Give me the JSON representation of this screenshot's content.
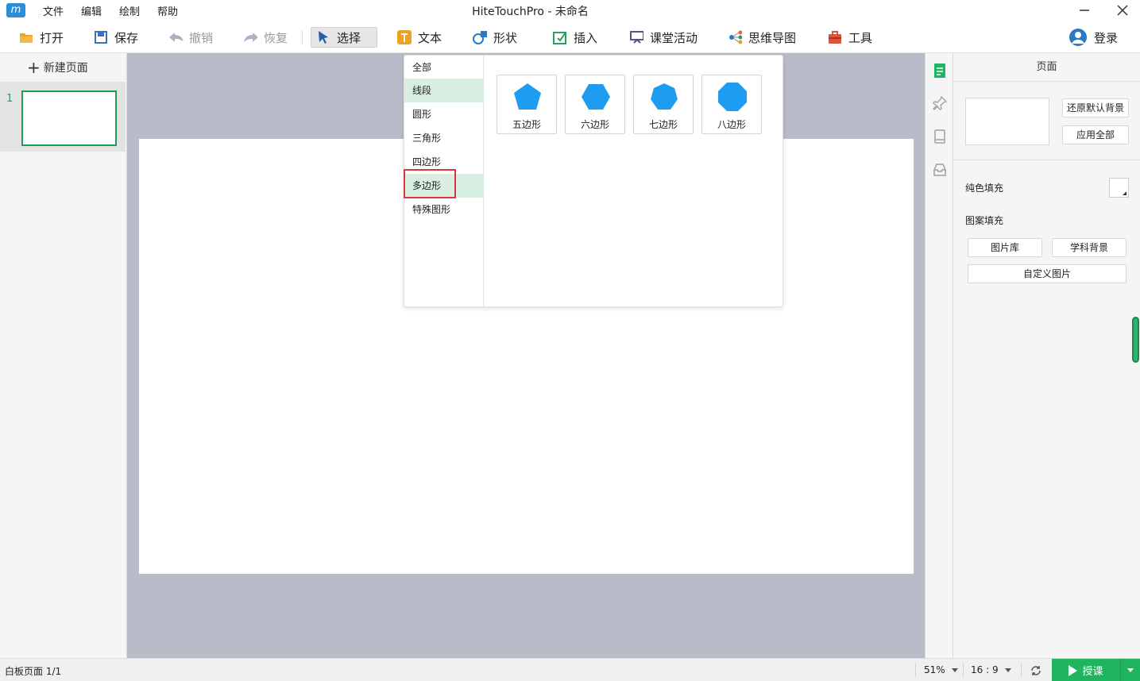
{
  "menu": [
    "文件",
    "编辑",
    "绘制",
    "帮助"
  ],
  "window_title": "HiteTouchPro - 未命名",
  "toolbar": {
    "open": "打开",
    "save": "保存",
    "undo": "撤销",
    "redo": "恢复",
    "select": "选择",
    "text": "文本",
    "shape": "形状",
    "insert": "插入",
    "class_activity": "课堂活动",
    "mind_map": "思维导图",
    "tools": "工具",
    "login": "登录"
  },
  "left_panel": {
    "new_page": "新建页面",
    "pages": [
      {
        "number": "1"
      }
    ]
  },
  "shape_popup": {
    "categories": [
      "全部",
      "线段",
      "圆形",
      "三角形",
      "四边形",
      "多边形",
      "特殊图形"
    ],
    "selected_category": "多边形",
    "shapes": [
      "五边形",
      "六边形",
      "七边形",
      "八边形"
    ],
    "shape_color": "#1e9cf0"
  },
  "props": {
    "title": "页面",
    "reset_bg": "还原默认背景",
    "apply_all": "应用全部",
    "solid_fill": "纯色填充",
    "pattern_fill": "图案填充",
    "image_lib": "图片库",
    "subject_bg": "学科背景",
    "custom_image": "自定义图片"
  },
  "status": {
    "page": "白板页面 1/1",
    "zoom": "51%",
    "ratio": "16 : 9",
    "teach": "授课"
  },
  "colors": {
    "accent": "#1fb45e",
    "highlight": "#d9363e"
  },
  "icons": [
    "folder-icon",
    "save-icon",
    "undo-icon",
    "redo-icon",
    "cursor-icon",
    "text-icon",
    "shape-icon",
    "insert-icon",
    "class-activity-icon",
    "mind-map-icon",
    "toolbox-icon",
    "user-icon",
    "page-icon",
    "pin-icon",
    "book-icon",
    "inbox-icon",
    "sync-icon",
    "play-icon"
  ]
}
